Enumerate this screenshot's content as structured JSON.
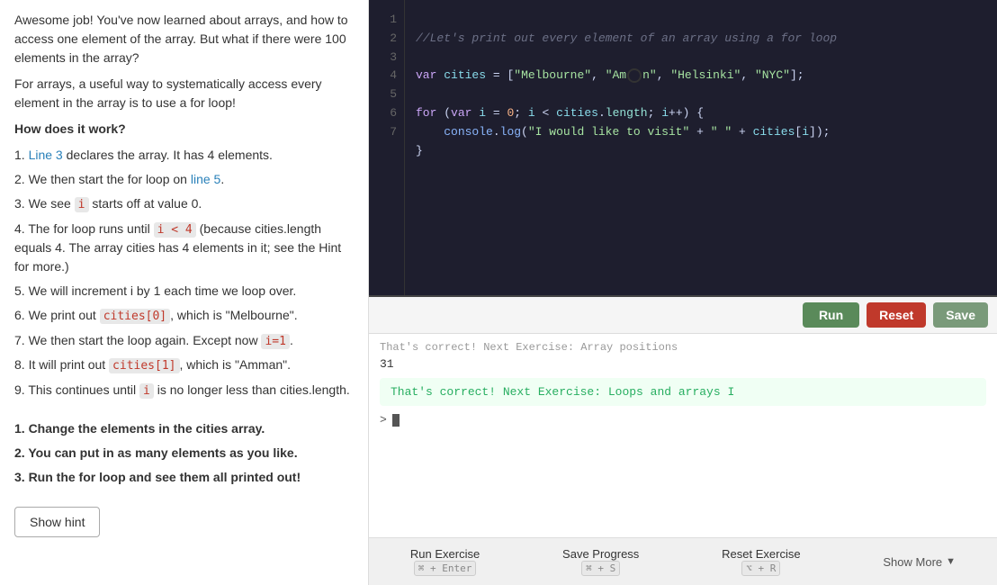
{
  "leftPanel": {
    "intro": "Awesome job! You've now learned about arrays, and how to access one element of the array. But what if there were 100 elements in the array?",
    "para2": "For arrays, a useful way to systematically access every element in the array is to use a for loop!",
    "heading": "How does it work?",
    "steps": [
      {
        "num": "1.",
        "text": " declares the array. It has 4 elements.",
        "linkText": "Line 3",
        "linkHref": "#"
      },
      {
        "num": "2.",
        "text": "We then start the for loop on ",
        "linkText": "line 5",
        "afterText": "."
      },
      {
        "num": "3.",
        "text": "We see ",
        "code": "i",
        "afterText": " starts off at value 0."
      },
      {
        "num": "4.",
        "text": "The for loop runs until ",
        "code": "i < 4",
        "afterText": " (because cities.length equals 4. The array cities has 4 elements in it; see the Hint for more.)"
      },
      {
        "num": "5.",
        "text": "We will increment i by 1 each time we loop over."
      },
      {
        "num": "6.",
        "text": "We print out ",
        "code": "cities[0]",
        "afterText": ", which is \"Melbourne\"."
      },
      {
        "num": "7.",
        "text": "We then start the loop again. Except now ",
        "code": "i=1",
        "afterText": "."
      },
      {
        "num": "8.",
        "text": "It will print out ",
        "code": "cities[1]",
        "afterText": ", which is \"Amman\"."
      },
      {
        "num": "9.",
        "text": "This continues until ",
        "code": "i",
        "afterText": " is no longer less than cities.length."
      }
    ],
    "boldItems": [
      {
        "num": "1.",
        "text": "Change the elements in the cities array."
      },
      {
        "num": "2.",
        "text": "You can put in as many elements as you like."
      },
      {
        "num": "3.",
        "text": "Run the for loop and see them all printed out!"
      }
    ],
    "showHintLabel": "Show hint"
  },
  "codeEditor": {
    "lines": [
      1,
      2,
      3,
      4,
      5,
      6,
      7
    ],
    "code": {
      "line1": "//Let's print out every element of an array using a for loop",
      "line2": "",
      "line3_pre": "var cities = [\"Melbourne\", \"",
      "line3_cursor": true,
      "line3_post": "n\", \"Helsinki\", \"NYC\"];",
      "line4": "",
      "line5": "for (var i = 0; i < cities.length; i++) {",
      "line6": "    console.log(\"I would like to visit\" + \" \" + cities[i]);",
      "line7": "}"
    }
  },
  "toolbar": {
    "runLabel": "Run",
    "resetLabel": "Reset",
    "saveLabel": "Save"
  },
  "console": {
    "prevMessage": "That's correct! Next Exercise: Array positions",
    "number": "31",
    "successMessage": "That's correct! Next Exercise: Loops and arrays I",
    "promptSymbol": ">"
  },
  "actionBar": {
    "runExercise": "Run Exercise",
    "runShortcut": "⌘ + Enter",
    "saveProgress": "Save Progress",
    "saveShortcut": "⌘ + S",
    "resetExercise": "Reset Exercise",
    "resetShortcut": "⌥ + R",
    "showMore": "Show More"
  }
}
